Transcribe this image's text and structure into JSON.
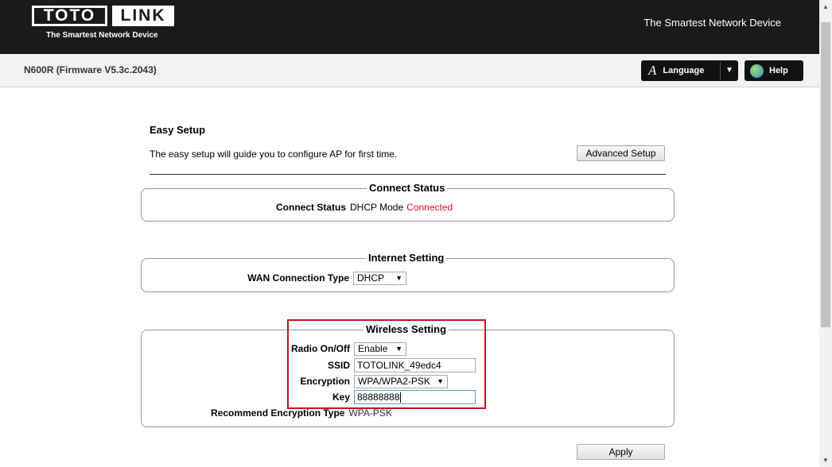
{
  "header": {
    "logo_left": "TOTO",
    "logo_right": "LINK",
    "logo_tagline": "The Smartest Network Device",
    "tagline": "The Smartest Network Device"
  },
  "subheader": {
    "model": "N600R (Firmware V5.3c.2043)",
    "language_icon": "A",
    "language_label": "Language",
    "help_label": "Help"
  },
  "page": {
    "title": "Easy Setup",
    "description": "The easy setup will guide you to configure AP for first time.",
    "advanced_button": "Advanced Setup",
    "apply_button": "Apply"
  },
  "connect_status": {
    "legend": "Connect Status",
    "label": "Connect Status",
    "mode": "DHCP Mode",
    "state": "Connected",
    "state_color": "#e0141e"
  },
  "internet_setting": {
    "legend": "Internet Setting",
    "wan_label": "WAN Connection Type",
    "wan_value": "DHCP"
  },
  "wireless_setting": {
    "legend": "Wireless Setting",
    "radio_label": "Radio On/Off",
    "radio_value": "Enable",
    "ssid_label": "SSID",
    "ssid_value": "TOTOLINK_49edc4",
    "encryption_label": "Encryption",
    "encryption_value": "WPA/WPA2-PSK",
    "key_label": "Key",
    "key_value": "88888888",
    "recommend_label": "Recommend Encryption Type",
    "recommend_value": "WPA-PSK"
  },
  "icons": {
    "caret": "▼",
    "scroll_up": "▲",
    "scroll_down": "▼"
  }
}
